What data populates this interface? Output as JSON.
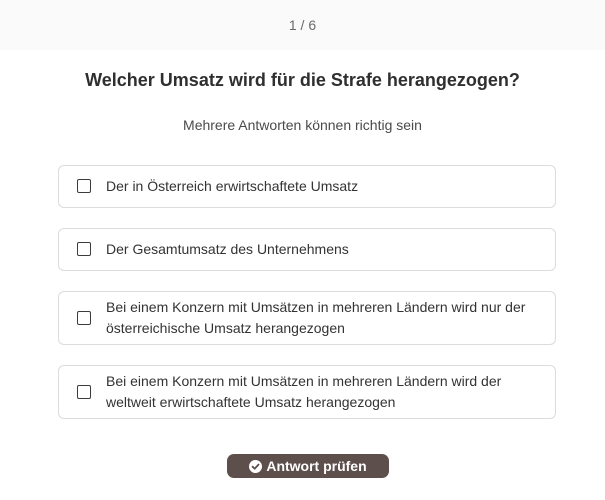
{
  "quiz": {
    "progress": "1 / 6",
    "question": "Welcher Umsatz wird für die Strafe herangezogen?",
    "hint": "Mehrere Antworten können richtig sein",
    "options": [
      {
        "label": "Der in Österreich erwirtschaftete Umsatz",
        "checked": false
      },
      {
        "label": "Der Gesamtumsatz des Unternehmens",
        "checked": false
      },
      {
        "label": "Bei einem Konzern mit Umsätzen in mehreren Ländern wird nur der österreichische Umsatz herangezogen",
        "checked": false
      },
      {
        "label": "Bei einem Konzern mit Umsätzen in mehreren Ländern wird der weltweit erwirtschaftete Umsatz herangezogen",
        "checked": false
      }
    ],
    "submit_label": "Antwort prüfen",
    "submit_icon": "check-circle-icon"
  },
  "colors": {
    "button_background": "#5d4f4b",
    "border": "#dcdcdc",
    "text": "#333333"
  }
}
